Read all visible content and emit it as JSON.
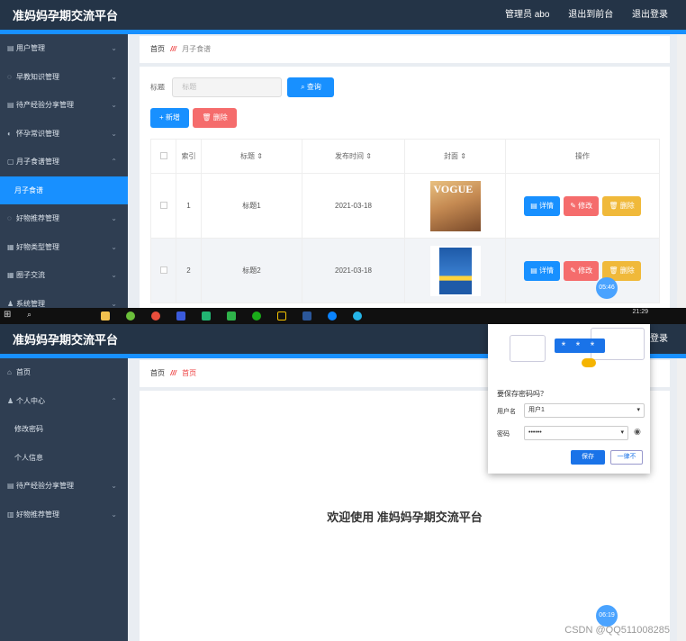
{
  "app_title": "准妈妈孕期交流平台",
  "shot1": {
    "header": {
      "admin": "管理员 abo",
      "front": "退出到前台",
      "logout": "退出登录"
    },
    "sidebar": [
      {
        "label": "用户管理",
        "icon": "▤",
        "chev": "⌄"
      },
      {
        "label": "早教知识管理",
        "icon": "◌",
        "chev": "⌄"
      },
      {
        "label": "待产经验分享管理",
        "icon": "▤",
        "chev": "⌄"
      },
      {
        "label": "怀孕常识管理",
        "icon": "◐",
        "chev": "⌄"
      },
      {
        "label": "月子食谱管理",
        "icon": "▢",
        "chev": "⌃"
      },
      {
        "label": "月子食谱",
        "icon": "",
        "chev": ""
      },
      {
        "label": "好物推荐管理",
        "icon": "◌",
        "chev": "⌄"
      },
      {
        "label": "好物类型管理",
        "icon": "▦",
        "chev": "⌄"
      },
      {
        "label": "圈子交流",
        "icon": "▦",
        "chev": "⌄"
      },
      {
        "label": "系统管理",
        "icon": "♟",
        "chev": "⌄"
      }
    ],
    "breadcrumb": {
      "home": "首页",
      "sep": "///",
      "current": "月子食谱"
    },
    "search": {
      "label": "标题",
      "placeholder": "标题",
      "button": "查询"
    },
    "actions": {
      "add": "+ 新增",
      "delete": "删除"
    },
    "table": {
      "headers": [
        "索引",
        "标题",
        "发布时间",
        "封面",
        "操作"
      ],
      "rows": [
        {
          "index": "1",
          "title": "标题1",
          "date": "2021-03-18",
          "cover_text": "VOGUE"
        },
        {
          "index": "2",
          "title": "标题2",
          "date": "2021-03-18",
          "cover_text": ""
        }
      ],
      "ops": {
        "detail": "详情",
        "edit": "修改",
        "delete": "删除"
      }
    },
    "timer": "05:46",
    "clock": "21:29"
  },
  "shot2": {
    "sidebar": [
      {
        "label": "首页",
        "icon": "⌂",
        "chev": ""
      },
      {
        "label": "个人中心",
        "icon": "♟",
        "chev": "⌃"
      },
      {
        "label": "修改密码",
        "icon": "",
        "chev": ""
      },
      {
        "label": "个人信息",
        "icon": "",
        "chev": ""
      },
      {
        "label": "待产经验分享管理",
        "icon": "▤",
        "chev": "⌄"
      },
      {
        "label": "好物推荐管理",
        "icon": "▥",
        "chev": "⌄"
      }
    ],
    "header_partial": "登录",
    "breadcrumb": {
      "home": "首页",
      "sep": "///",
      "current": "首页"
    },
    "welcome": "欢迎使用 准妈妈孕期交流平台",
    "dialog": {
      "title": "要保存密码吗？",
      "pw_mask": "* * *",
      "user_label": "用户名",
      "user_value": "用户1",
      "pwd_label": "密码",
      "pwd_value": "••••••",
      "save": "保存",
      "never": "一律不"
    },
    "timer": "06:19",
    "watermark": "CSDN @QQ511008285"
  }
}
